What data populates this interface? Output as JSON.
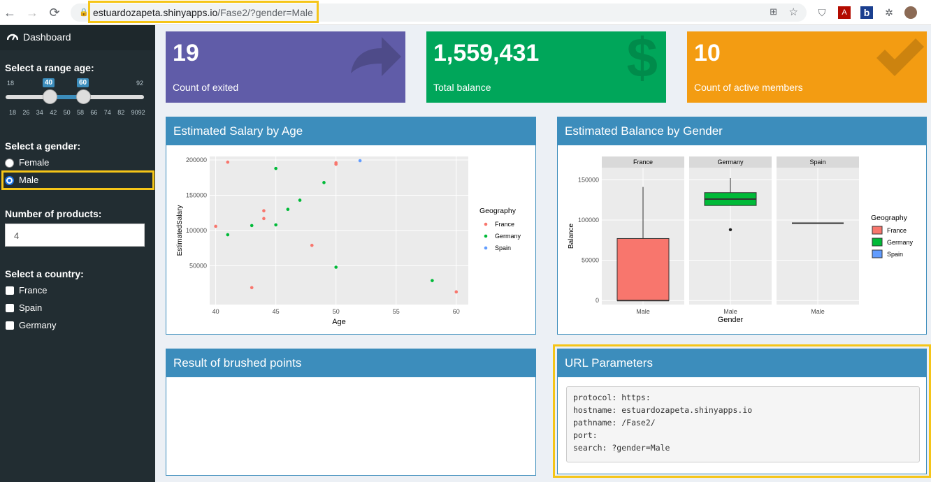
{
  "browser": {
    "url_host": "estuardozapeta.shinyapps.io",
    "url_path": "/Fase2/?gender=Male"
  },
  "sidebar": {
    "dashboard_label": "Dashboard",
    "age": {
      "label": "Select a range age:",
      "min": "18",
      "max": "92",
      "from": "40",
      "to": "60",
      "ticks": [
        "18",
        "26",
        "34",
        "42",
        "50",
        "58",
        "66",
        "74",
        "82",
        "9092"
      ]
    },
    "gender": {
      "label": "Select a gender:",
      "options": [
        "Female",
        "Male"
      ],
      "selected": "Male"
    },
    "products": {
      "label": "Number of products:",
      "value": "4"
    },
    "country": {
      "label": "Select a country:",
      "options": [
        "France",
        "Spain",
        "Germany"
      ]
    }
  },
  "value_boxes": [
    {
      "value": "19",
      "label": "Count of exited",
      "color": "#605ca8",
      "icon": "share-arrow-icon"
    },
    {
      "value": "1,559,431",
      "label": "Total balance",
      "color": "#00a65a",
      "icon": "dollar-icon"
    },
    {
      "value": "10",
      "label": "Count of active members",
      "color": "#f39c12",
      "icon": "check-icon"
    }
  ],
  "panels": {
    "salary_title": "Estimated Salary by Age",
    "balance_title": "Estimated Balance by Gender",
    "brushed_title": "Result of brushed points",
    "url_title": "URL Parameters",
    "url_lines": [
      "protocol: https:",
      "hostname: estuardozapeta.shinyapps.io",
      "pathname: /Fase2/",
      "port:",
      "search: ?gender=Male"
    ]
  },
  "colors": {
    "France": "#f8766d",
    "Germany": "#00ba38",
    "Spain": "#619cff"
  },
  "chart_data": [
    {
      "type": "scatter",
      "xlabel": "Age",
      "ylabel": "EstimatedSalary",
      "xlim": [
        39.5,
        61
      ],
      "ylim": [
        -5000,
        205000
      ],
      "xticks": [
        40,
        45,
        50,
        55,
        60
      ],
      "yticks": [
        50000,
        100000,
        150000,
        200000
      ],
      "legend_title": "Geography",
      "legend": [
        "France",
        "Germany",
        "Spain"
      ],
      "series": [
        {
          "name": "France",
          "points": [
            [
              40,
              106000
            ],
            [
              41,
              197000
            ],
            [
              43,
              19000
            ],
            [
              44,
              128000
            ],
            [
              44,
              117000
            ],
            [
              48,
              79000
            ],
            [
              50,
              194000
            ],
            [
              50,
              196000
            ],
            [
              60,
              13000
            ]
          ]
        },
        {
          "name": "Germany",
          "points": [
            [
              41,
              94000
            ],
            [
              43,
              107000
            ],
            [
              45,
              188000
            ],
            [
              45,
              108000
            ],
            [
              46,
              130000
            ],
            [
              47,
              143000
            ],
            [
              49,
              168000
            ],
            [
              50,
              48000
            ],
            [
              58,
              29000
            ]
          ]
        },
        {
          "name": "Spain",
          "points": [
            [
              52,
              199000
            ]
          ]
        }
      ]
    },
    {
      "type": "box",
      "xlabel": "Gender",
      "ylabel": "Balance",
      "ylim": [
        -5000,
        165000
      ],
      "yticks": [
        0,
        50000,
        100000,
        150000
      ],
      "facets": [
        "France",
        "Germany",
        "Spain"
      ],
      "category": "Male",
      "legend_title": "Geography",
      "legend": [
        "France",
        "Germany",
        "Spain"
      ],
      "boxes": [
        {
          "facet": "France",
          "min": 0,
          "q1": 0,
          "median": 0,
          "q3": 77000,
          "max": 141000,
          "outliers": []
        },
        {
          "facet": "Germany",
          "min": 118000,
          "q1": 118000,
          "median": 126000,
          "q3": 134000,
          "max": 152000,
          "outliers": [
            88000
          ]
        },
        {
          "facet": "Spain",
          "min": 96000,
          "q1": 96000,
          "median": 96000,
          "q3": 96000,
          "max": 96000,
          "outliers": []
        }
      ]
    }
  ]
}
